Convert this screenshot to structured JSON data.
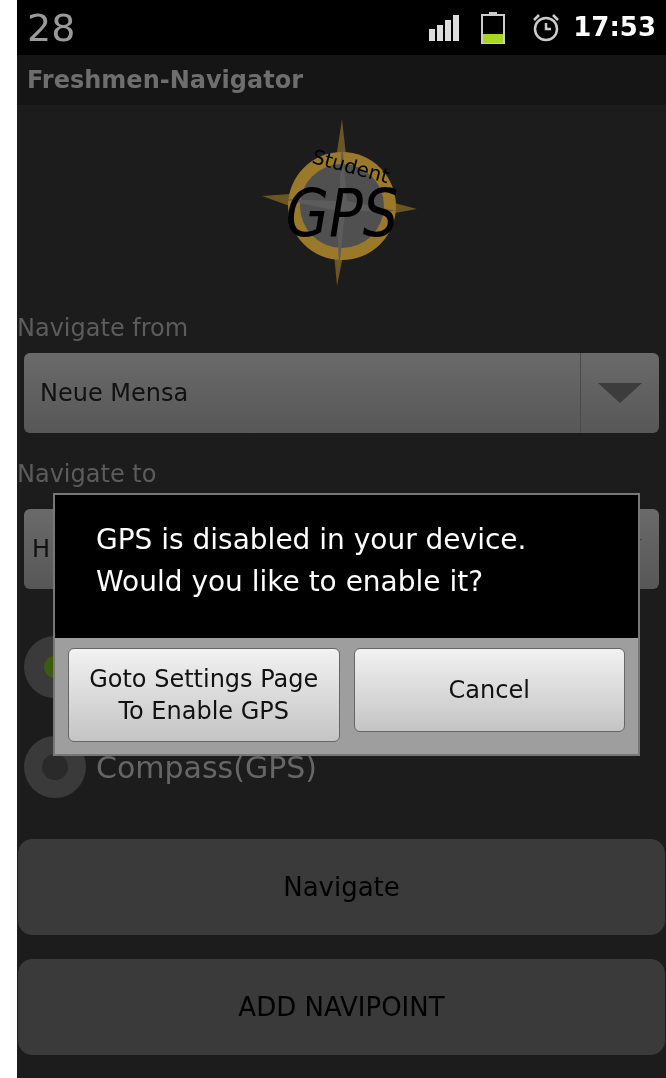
{
  "status_bar": {
    "notification": "28",
    "time": "17:53"
  },
  "title_bar": {
    "title": "Freshmen-Navigator"
  },
  "logo": {
    "top_text": "Student",
    "main_text": "GPS"
  },
  "from": {
    "label": "Navigate from",
    "value": "Neue Mensa"
  },
  "to": {
    "label": "Navigate to",
    "value": "H"
  },
  "radios": [
    {
      "selected": true
    },
    {
      "label": "Compass(GPS)",
      "selected": false
    }
  ],
  "buttons": [
    "Navigate",
    "ADD NAVIPOINT"
  ],
  "dialog": {
    "message": "GPS is disabled in your device. Would you like to enable it?",
    "buttons": [
      "Goto Settings Page To Enable GPS",
      "Cancel"
    ]
  }
}
